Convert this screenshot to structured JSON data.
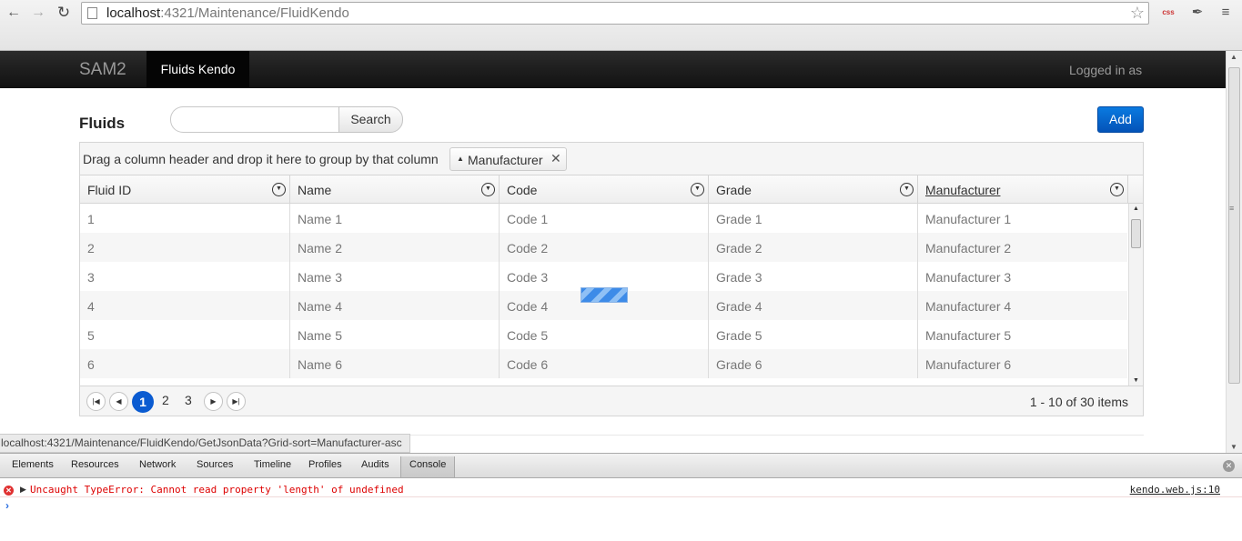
{
  "browser": {
    "url_host": "localhost",
    "url_rest": ":4321/Maintenance/FluidKendo",
    "status_url": "localhost:4321/Maintenance/FluidKendo/GetJsonData?Grid-sort=Manufacturer-asc"
  },
  "navbar": {
    "brand": "SAM2",
    "active_item": "Fluids Kendo",
    "logged_in": "Logged in as"
  },
  "page": {
    "title": "Fluids",
    "search_label": "Search",
    "search_value": "",
    "add_label": "Add"
  },
  "grid": {
    "group_hint": "Drag a column header and drop it here to group by that column",
    "group_chip": "Manufacturer",
    "columns": [
      "Fluid ID",
      "Name",
      "Code",
      "Grade",
      "Manufacturer"
    ],
    "rows": [
      [
        "1",
        "Name 1",
        "Code 1",
        "Grade 1",
        "Manufacturer 1"
      ],
      [
        "2",
        "Name 2",
        "Code 2",
        "Grade 2",
        "Manufacturer 2"
      ],
      [
        "3",
        "Name 3",
        "Code 3",
        "Grade 3",
        "Manufacturer 3"
      ],
      [
        "4",
        "Name 4",
        "Code 4",
        "Grade 4",
        "Manufacturer 4"
      ],
      [
        "5",
        "Name 5",
        "Code 5",
        "Grade 5",
        "Manufacturer 5"
      ],
      [
        "6",
        "Name 6",
        "Code 6",
        "Grade 6",
        "Manufacturer 6"
      ]
    ],
    "pager": {
      "pages": [
        "1",
        "2",
        "3"
      ],
      "current": "1",
      "info": "1 - 10 of 30 items"
    }
  },
  "devtools": {
    "tabs": [
      "Elements",
      "Resources",
      "Network",
      "Sources",
      "Timeline",
      "Profiles",
      "Audits",
      "Console"
    ],
    "active_tab": "Console",
    "error_message": "Uncaught TypeError: Cannot read property 'length' of undefined",
    "error_source": "kendo.web.js:10",
    "prompt": "›"
  },
  "icons": {
    "back": "arrow-left-icon",
    "forward": "arrow-right-icon",
    "reload": "reload-icon",
    "star": "star-icon",
    "filter": "filter-icon",
    "error": "error-icon"
  },
  "colors": {
    "navbar": "#111111",
    "primary_button": "#0453b8",
    "active_page": "#0a5bd1",
    "error_text": "#dd0000"
  }
}
